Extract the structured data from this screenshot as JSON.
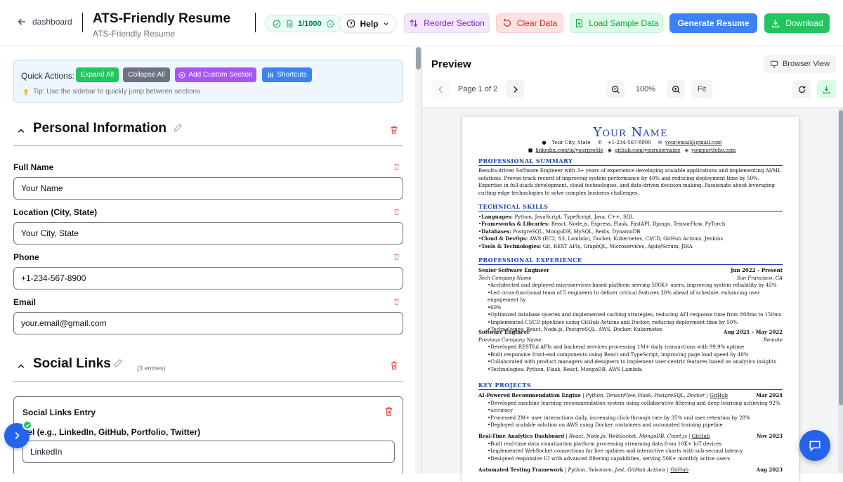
{
  "header": {
    "back_label": "dashboard",
    "title": "ATS-Friendly Resume",
    "subtitle": "ATS-Friendly Resume",
    "credits": "1/1000",
    "help_label": "Help",
    "reorder_label": "Reorder Section",
    "clear_label": "Clear Data",
    "sample_label": "Load Sample Data",
    "generate_label": "Generate Resume",
    "download_label": "Download"
  },
  "quick_actions": {
    "label": "Quick Actions:",
    "expand": "Expand All",
    "collapse": "Collapse All",
    "custom": "Add Custom Section",
    "shortcuts": "Shortcuts",
    "tip": "Tip: Use the sidebar to quickly jump between sections"
  },
  "personal": {
    "title": "Personal Information",
    "fields": [
      {
        "label": "Full Name",
        "value": "Your Name"
      },
      {
        "label": "Location (City, State)",
        "value": "Your City, State"
      },
      {
        "label": "Phone",
        "value": "+1-234-567-8900"
      },
      {
        "label": "Email",
        "value": "your.email@gmail.com"
      }
    ]
  },
  "social": {
    "title": "Social Links",
    "entries": "(3 entries)",
    "entry_title": "Social Links Entry",
    "entry_label": "Label (e.g., LinkedIn, GitHub, Portfolio, Twitter)",
    "entry_label_visible": "bel (e.g., LinkedIn, GitHub, Portfolio, Twitter)",
    "entry_value": "LinkedIn"
  },
  "preview": {
    "title": "Preview",
    "browser_view": "Browser View",
    "page": "Page 1 of 2",
    "zoom": "100%",
    "fit": "Fit"
  },
  "resume": {
    "name": "Your Name",
    "location": "Your City, State",
    "phone": "+1-234-567-8900",
    "email": "your.email@gmail.com",
    "linkedin": "linkedin.com/in/yourprofile",
    "github": "github.com/yourusername",
    "portfolio": "yourportfolio.com",
    "summary_title": "PROFESSIONAL SUMMARY",
    "summary": "Results-driven Software Engineer with 3+ years of experience developing scalable applications and implementing AI/ML solutions. Proven track record of improving system performance by 40% and reducing deployment time by 50%. Expertise in full-stack development, cloud technologies, and data-driven decision making. Passionate about leveraging cutting-edge technologies to solve complex business challenges.",
    "skills_title": "TECHNICAL SKILLS",
    "skills": [
      {
        "k": "Languages:",
        "v": "Python, JavaScript, TypeScript, Java, C++, SQL"
      },
      {
        "k": "Frameworks & Libraries:",
        "v": "React, Node.js, Express, Flask, FastAPI, Django, TensorFlow, PyTorch"
      },
      {
        "k": "Databases:",
        "v": "PostgreSQL, MongoDB, MySQL, Redis, DynamoDB"
      },
      {
        "k": "Cloud & DevOps:",
        "v": "AWS (EC2, S3, Lambda), Docker, Kubernetes, CI/CD, GitHub Actions, Jenkins"
      },
      {
        "k": "Tools & Technologies:",
        "v": "Git, REST APIs, GraphQL, Microservices, Agile/Scrum, JIRA"
      }
    ],
    "exp_title": "PROFESSIONAL EXPERIENCE",
    "jobs": [
      {
        "role": "Senior Software Engineer",
        "dates": "Jun 2022 – Present",
        "company": "Tech Company Name",
        "place": "San Francisco, CA",
        "bullets": [
          "Architected and deployed microservices-based platform serving 500K+ users, improving system reliability by 45%",
          "Led cross-functional team of 5 engineers to deliver critical features 30% ahead of schedule, enhancing user engagement by",
          "60%",
          "Optimized database queries and implemented caching strategies, reducing API response time from 800ms to 150ms",
          "Implemented CI/CD pipelines using GitHub Actions and Docker, reducing deployment time by 50%",
          "Technologies: React, Node.js, PostgreSQL, AWS, Docker, Kubernetes"
        ]
      },
      {
        "role": "Software Engineer",
        "dates": "Aug 2021 – May 2022",
        "company": "Previous Company Name",
        "place": "Remote",
        "bullets": [
          "Developed RESTful APIs and backend services processing 1M+ daily transactions with 99.9% uptime",
          "Built responsive front-end components using React and TypeScript, improving page load speed by 40%",
          "Collaborated with product managers and designers to implement user-centric features based on analytics insights",
          "Technologies: Python, Flask, React, MongoDB, AWS Lambda"
        ]
      }
    ],
    "proj_title": "KEY PROJECTS",
    "projects": [
      {
        "name": "AI-Powered Recommendation Engine",
        "tech": "Python, TensorFlow, Flask, PostgreSQL, Docker",
        "link": "GitHub",
        "date": "Mar 2024",
        "bullets": [
          "Developed machine learning recommendation system using collaborative filtering and deep learning achieving 92%",
          "accuracy",
          "Processed 2M+ user interactions daily, increasing click-through rate by 35% and user retention by 28%",
          "Deployed scalable solution on AWS using Docker containers and automated training pipeline"
        ]
      },
      {
        "name": "Real-Time Analytics Dashboard",
        "tech": "React, Node.js, WebSocket, MongoDB, Chart.js",
        "link": "GitHub",
        "date": "Nov 2023",
        "bullets": [
          "Built real-time data visualization platform processing streaming data from 10K+ IoT devices",
          "Implemented WebSocket connections for live updates and interactive charts with sub-second latency",
          "Designed responsive UI with advanced filtering capabilities, serving 50K+ monthly active users"
        ]
      },
      {
        "name": "Automated Testing Framework",
        "tech": "Python, Selenium, Jest, GitHub Actions",
        "link": "GitHub",
        "date": "Aug 2023",
        "bullets": []
      }
    ]
  }
}
